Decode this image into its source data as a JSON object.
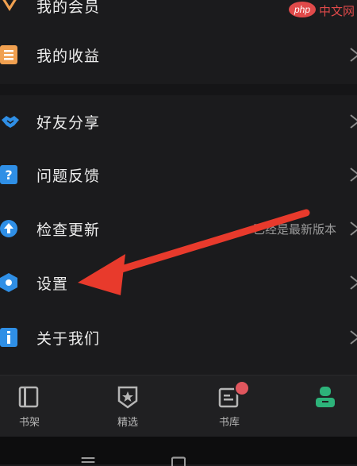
{
  "menu": {
    "items": [
      {
        "label": "我的会员",
        "icon": "crown-icon"
      },
      {
        "label": "我的收益",
        "icon": "earnings-icon"
      },
      {
        "label": "好友分享",
        "icon": "handshake-icon"
      },
      {
        "label": "问题反馈",
        "icon": "question-icon"
      },
      {
        "label": "检查更新",
        "icon": "update-arrow-icon",
        "note": "已经是最新版本"
      },
      {
        "label": "设置",
        "icon": "hexagon-settings-icon"
      },
      {
        "label": "关于我们",
        "icon": "info-icon"
      }
    ]
  },
  "tabbar": {
    "tabs": [
      {
        "label": "书架",
        "icon": "bookshelf-icon"
      },
      {
        "label": "精选",
        "icon": "featured-star-icon"
      },
      {
        "label": "书库",
        "icon": "library-icon",
        "badge": true
      },
      {
        "label": "",
        "icon": "profile-icon",
        "active": true
      }
    ]
  },
  "watermark": {
    "text_php": "php",
    "text_cn": "中文网"
  },
  "colors": {
    "background": "#1b1b1d",
    "accent_blue": "#2f8fe6",
    "accent_orange": "#f0a050",
    "accent_green": "#2db37a",
    "badge_red": "#e0565e",
    "arrow_red": "#e83a2c"
  }
}
